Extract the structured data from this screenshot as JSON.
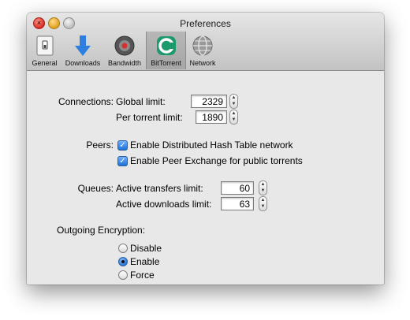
{
  "window": {
    "title": "Preferences"
  },
  "toolbar": {
    "items": [
      {
        "label": "General",
        "icon": "switch-icon"
      },
      {
        "label": "Downloads",
        "icon": "download-arrow-icon"
      },
      {
        "label": "Bandwidth",
        "icon": "disc-icon"
      },
      {
        "label": "BitTorrent",
        "icon": "bittorrent-icon",
        "selected": true
      },
      {
        "label": "Network",
        "icon": "globe-icon"
      }
    ]
  },
  "connections": {
    "section_label": "Connections:",
    "global_limit_label": "Global limit:",
    "global_limit_value": "2329",
    "per_torrent_label": "Per torrent limit:",
    "per_torrent_value": "1890"
  },
  "peers": {
    "section_label": "Peers:",
    "dht_label": "Enable Distributed Hash Table network",
    "dht_checked": true,
    "pex_label": "Enable Peer Exchange for public torrents",
    "pex_checked": true
  },
  "queues": {
    "section_label": "Queues:",
    "active_transfers_label": "Active transfers limit:",
    "active_transfers_value": "60",
    "active_downloads_label": "Active downloads limit:",
    "active_downloads_value": "63"
  },
  "encryption": {
    "section_label": "Outgoing Encryption:",
    "options": [
      "Disable",
      "Enable",
      "Force"
    ],
    "selected": "Enable"
  },
  "colors": {
    "checkbox_blue": "#1f6fd8",
    "window_bg": "#e8e8e8"
  }
}
